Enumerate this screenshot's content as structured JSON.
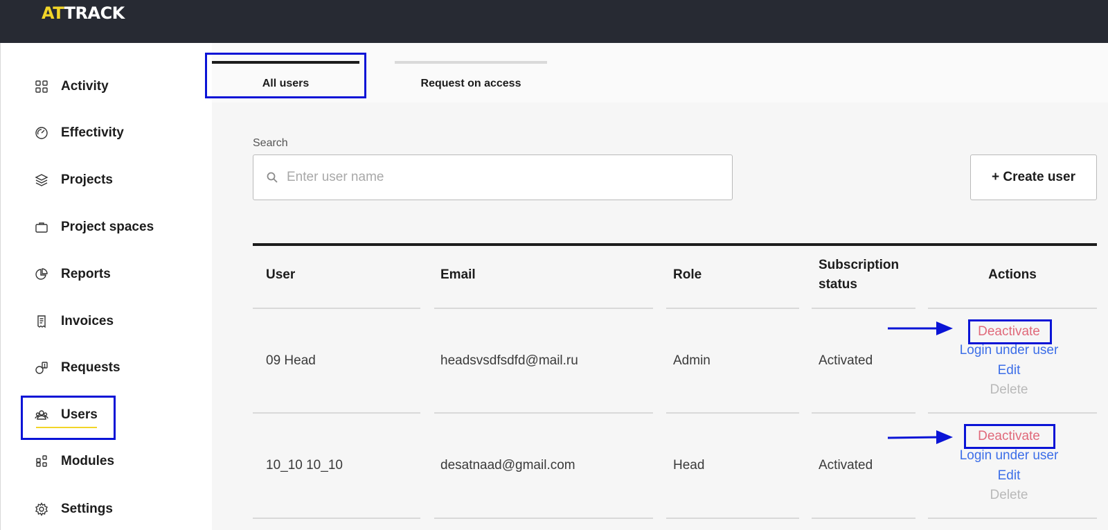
{
  "app": {
    "logo_accent": "AT",
    "logo_rest": "TRACK",
    "accent_color": "#f2d528",
    "topbar_color": "#272a33"
  },
  "sidebar": {
    "items": [
      {
        "label": "Activity",
        "icon": "grid-icon"
      },
      {
        "label": "Effectivity",
        "icon": "gauge-icon"
      },
      {
        "label": "Projects",
        "icon": "layers-icon"
      },
      {
        "label": "Project spaces",
        "icon": "briefcase-icon"
      },
      {
        "label": "Reports",
        "icon": "pie-chart-icon"
      },
      {
        "label": "Invoices",
        "icon": "receipt-icon"
      },
      {
        "label": "Requests",
        "icon": "request-icon"
      },
      {
        "label": "Users",
        "icon": "users-icon",
        "active": true
      },
      {
        "label": "Modules",
        "icon": "modules-icon"
      },
      {
        "label": "Settings",
        "icon": "gear-icon"
      }
    ]
  },
  "tabs": [
    {
      "label": "All users",
      "active": true
    },
    {
      "label": "Request on access",
      "active": false
    }
  ],
  "search": {
    "label": "Search",
    "placeholder": "Enter user name",
    "value": ""
  },
  "create_button": "+ Create user",
  "table": {
    "columns": [
      "User",
      "Email",
      "Role",
      "Subscription status",
      "Actions"
    ],
    "rows": [
      {
        "user": "09 Head",
        "email": "headsvsdfsdfd@mail.ru",
        "role": "Admin",
        "status": "Activated",
        "actions": {
          "deactivate": "Deactivate",
          "login": "Login under user",
          "edit": "Edit",
          "delete": "Delete"
        }
      },
      {
        "user": "10_10 10_10",
        "email": "desatnaad@gmail.com",
        "role": "Head",
        "status": "Activated",
        "actions": {
          "deactivate": "Deactivate",
          "login": "Login under user",
          "edit": "Edit",
          "delete": "Delete"
        }
      }
    ]
  },
  "colors": {
    "highlight": "#0a14d6",
    "deactivate": "#e0697a",
    "link": "#3c6ee8",
    "disabled": "#b9b9b9"
  }
}
